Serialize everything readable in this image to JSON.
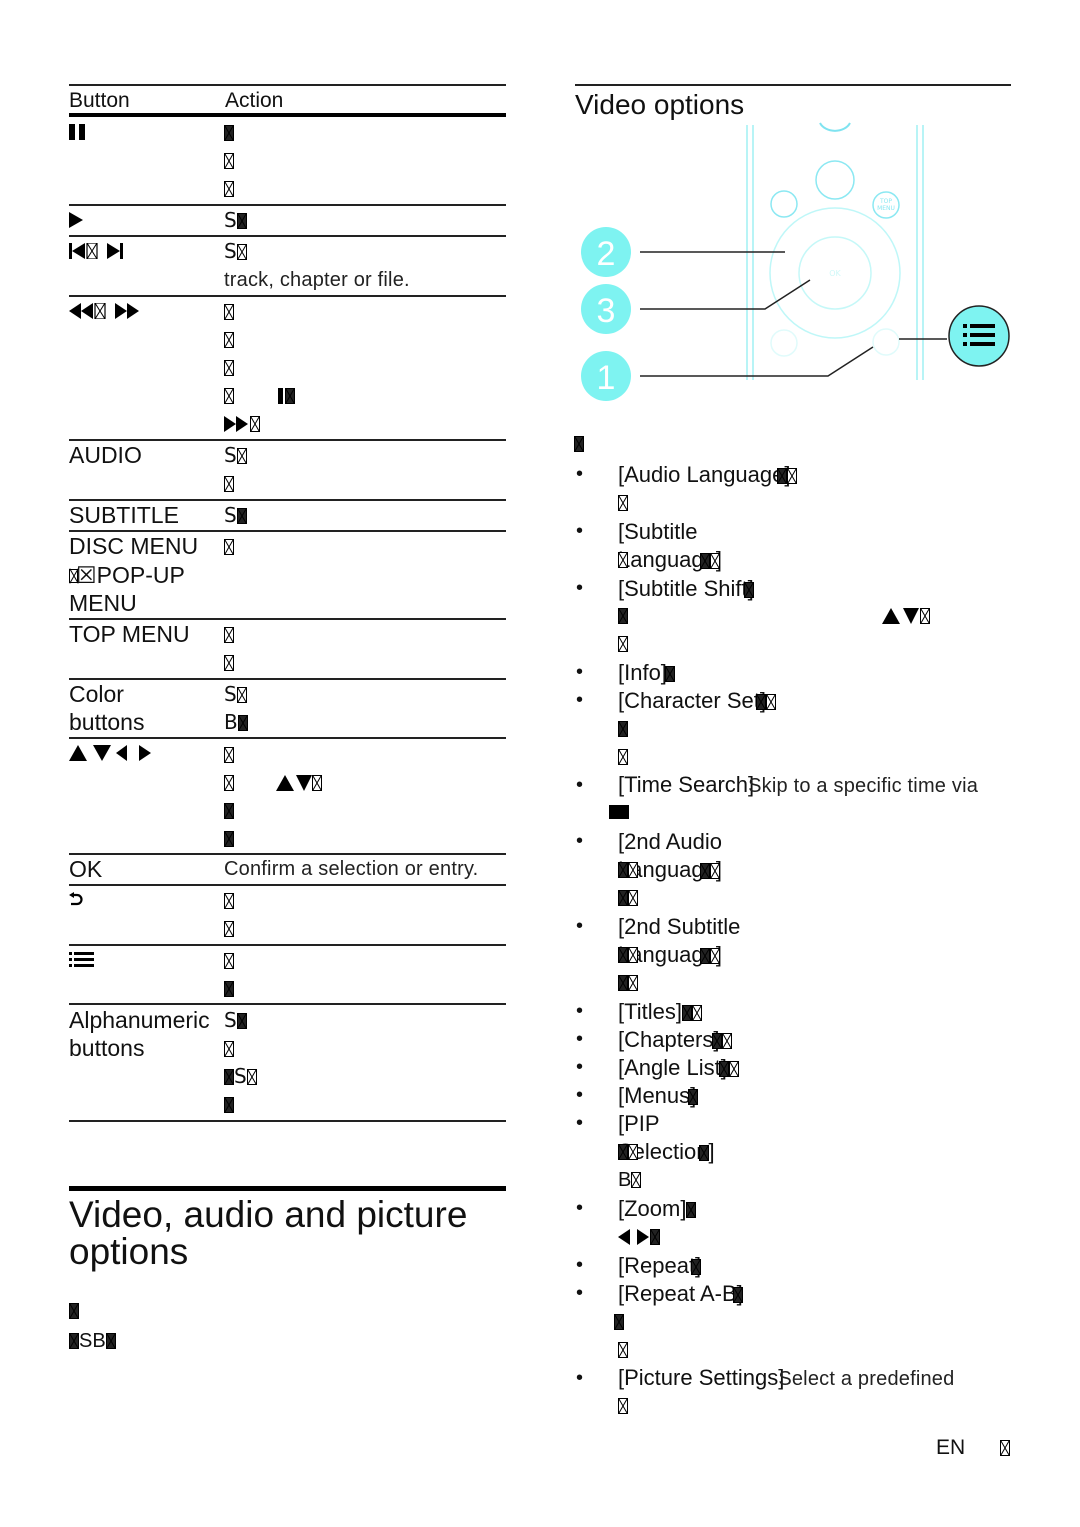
{
  "table": {
    "headers": {
      "button": "Button",
      "action": "Action"
    },
    "rows": [
      {
        "button_icon": "pause-icon",
        "button_text": "",
        "actions": [
          "☒",
          "☒",
          "☒"
        ]
      },
      {
        "button_icon": "play-icon",
        "button_text": "",
        "actions": [
          "S☒"
        ]
      },
      {
        "button_icon": "previous-next-icon",
        "button_text": "☒",
        "actions": [
          "S☒",
          "track, chapter or file."
        ]
      },
      {
        "button_icon": "rewind-fastforward-icon",
        "button_text": "☒",
        "actions": [
          "☒",
          "☒",
          "☒",
          "☒      ❚☒",
          "▶▶☒"
        ]
      },
      {
        "button_icon": "",
        "button_text": "AUDIO",
        "actions": [
          "S☒",
          "☒"
        ]
      },
      {
        "button_icon": "",
        "button_text": "SUBTITLE",
        "actions": [
          "S☒"
        ]
      },
      {
        "button_icon": "",
        "button_text": "DISC MENU ☒POP-UP MENU",
        "button_lines": [
          "DISC MENU",
          "☒POP-UP",
          "MENU"
        ],
        "actions": [
          "☒"
        ]
      },
      {
        "button_icon": "",
        "button_text": "TOP MENU",
        "actions": [
          "☒",
          "☒"
        ]
      },
      {
        "button_icon": "",
        "button_text": "Color buttons",
        "button_lines": [
          "Color",
          "buttons"
        ],
        "actions": [
          "S☒",
          "B☒"
        ]
      },
      {
        "button_icon": "navigation-arrows-icon",
        "button_text": "",
        "actions": [
          "☒",
          "☒      ▲▼☒",
          "☒",
          "☒"
        ]
      },
      {
        "button_icon": "",
        "button_text": "OK",
        "actions": [
          "Confirm a selection or entry."
        ]
      },
      {
        "button_icon": "back-icon",
        "button_text": "",
        "actions": [
          "☒",
          "☒"
        ]
      },
      {
        "button_icon": "options-menu-icon",
        "button_text": "",
        "actions": [
          "☒",
          "☒"
        ]
      },
      {
        "button_icon": "",
        "button_text": "Alphanumeric buttons",
        "button_lines": [
          "Alphanumeric",
          "buttons"
        ],
        "actions": [
          "S☒",
          "☒",
          "☒S☒",
          "☒"
        ]
      }
    ]
  },
  "section": {
    "title_line1": "Video, audio and picture",
    "title_line2": "options",
    "para_line1": "☒",
    "para_line2": "☒SB☒"
  },
  "video_options": {
    "title": "Video options",
    "illustration": {
      "callouts": [
        "2",
        "3",
        "1"
      ],
      "remote_labels": {
        "ok": "OK",
        "top_menu_1": "TOP",
        "top_menu_2": "MENU"
      },
      "accent_color": "#7ef3f1"
    },
    "intro": "☒",
    "items": [
      {
        "label": "[Audio Language]",
        "suffix": "☒",
        "lines": [
          "☒"
        ]
      },
      {
        "label": "[Subtitle Language]",
        "suffix": "☒",
        "lines": [
          "☒"
        ]
      },
      {
        "label": "[Subtitle Shift]",
        "suffix": "☒",
        "lines": [
          "☒                     ▲▼☒",
          "☒"
        ]
      },
      {
        "label": "[Info]",
        "suffix": "☒",
        "lines": []
      },
      {
        "label": "[Character Set]",
        "suffix": "☒",
        "lines": [
          "☒",
          "☒"
        ]
      },
      {
        "label": "[Time Search]",
        "suffix": "Skip to a specific time via",
        "lines": [
          "■"
        ]
      },
      {
        "label": "[2nd Audio Language]",
        "suffix": "☒",
        "lines": [
          "☒☒",
          "☒☒"
        ]
      },
      {
        "label": "[2nd Subtitle Language]",
        "suffix": "☒",
        "lines": [
          "☒☒",
          "☒☒"
        ]
      },
      {
        "label": "[Titles]",
        "suffix": "☒☒",
        "lines": []
      },
      {
        "label": "[Chapters]",
        "suffix": "☒☒",
        "lines": []
      },
      {
        "label": "[Angle List]",
        "suffix": "☒☒",
        "lines": []
      },
      {
        "label": "[Menus]",
        "suffix": "☒",
        "lines": []
      },
      {
        "label": "[PIP Selection]",
        "suffix": "☒",
        "lines": [
          "☒☒",
          "B☒"
        ]
      },
      {
        "label": "[Zoom]",
        "suffix": "☒",
        "lines": [
          "◀▶☒"
        ]
      },
      {
        "label": "[Repeat]",
        "suffix": "☒",
        "lines": []
      },
      {
        "label": "[Repeat A-B]",
        "suffix": "☒",
        "lines": [
          "☒",
          "☒"
        ]
      },
      {
        "label": "[Picture Settings]",
        "suffix": "Select a predefined",
        "lines": [
          "☒"
        ]
      }
    ]
  },
  "footer": {
    "language": "EN",
    "page": "☒"
  }
}
